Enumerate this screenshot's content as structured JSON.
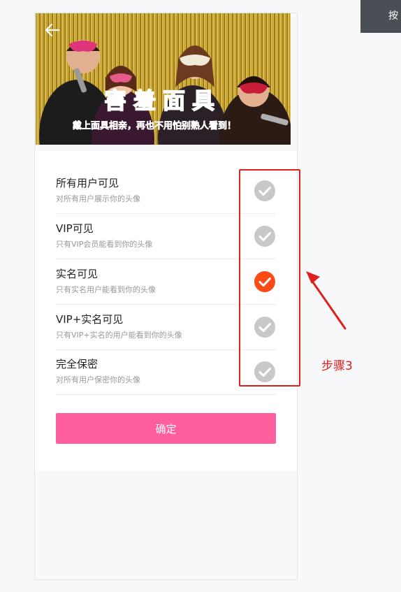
{
  "corner_button": {
    "label": "按"
  },
  "banner": {
    "title": "害羞面具",
    "subtitle": "戴上面具相亲，再也不用怕别熟人看到！"
  },
  "options": [
    {
      "title": "所有用户可见",
      "desc": "对所有用户展示你的头像",
      "selected": false
    },
    {
      "title": "VIP可见",
      "desc": "只有VIP会员能看到你的头像",
      "selected": false
    },
    {
      "title": "实名可见",
      "desc": "只有实名用户能看到你的头像",
      "selected": true
    },
    {
      "title": "VIP+实名可见",
      "desc": "只有VIP+实名的用户能看到你的头像",
      "selected": false
    },
    {
      "title": "完全保密",
      "desc": "对所有用户保密你的头像",
      "selected": false
    }
  ],
  "confirm_label": "确定",
  "annotation": {
    "step_label": "步骤3"
  },
  "colors": {
    "accent": "#ff5f9d",
    "selected_check": "#fa4b16",
    "unselected_check": "#c8c8c8",
    "annotation_red": "#e0201d"
  }
}
